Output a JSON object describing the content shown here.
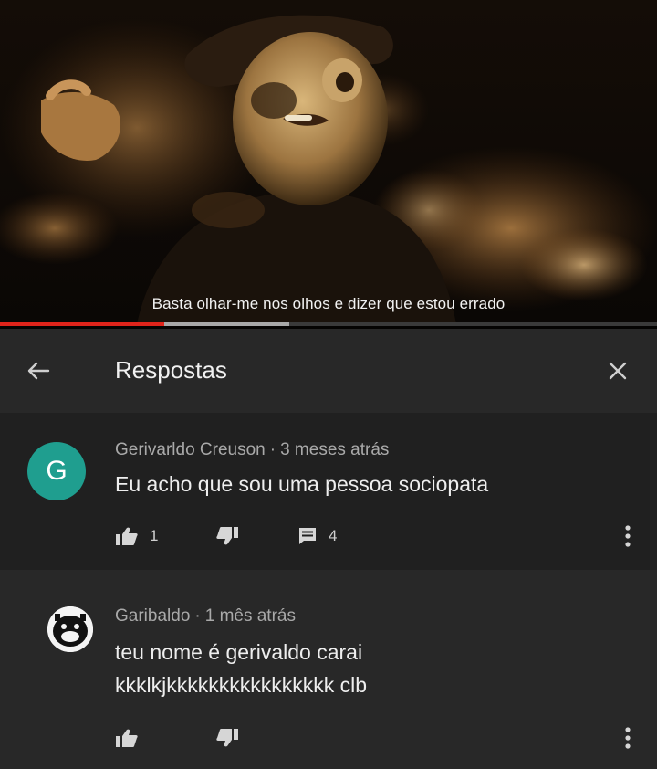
{
  "video": {
    "subtitle": "Basta olhar-me nos olhos e dizer que estou errado",
    "progress_played": 0.25,
    "progress_buffered": 0.44
  },
  "header": {
    "title": "Respostas",
    "back_icon": "arrow-left-icon",
    "close_icon": "close-icon"
  },
  "comments": [
    {
      "avatar_letter": "G",
      "avatar_color": "#1f9e8f",
      "author": "Gerivarldo Creuson",
      "time": "3 meses atrás",
      "lines": [
        "Eu acho que sou uma pessoa sociopata"
      ],
      "likes": "1",
      "replies": "4"
    },
    {
      "author": "Garibaldo",
      "time": "1 mês atrás",
      "lines": [
        "teu nome é gerivaldo carai",
        "kkklkjkkkkkkkkkkkkkkkk clb"
      ]
    }
  ],
  "colors": {
    "progress_played": "#e0241b",
    "progress_buffer": "#a8a8a8",
    "panel": "#202020",
    "panel_alt": "#282828"
  }
}
